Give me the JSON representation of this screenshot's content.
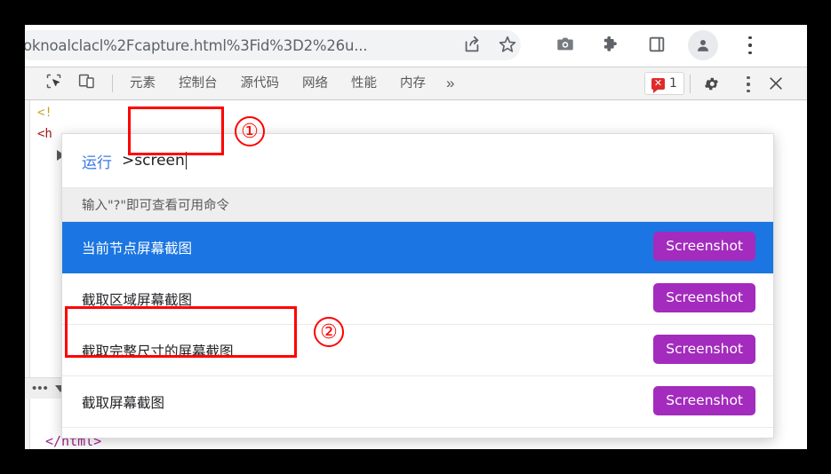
{
  "browser": {
    "omnibox": {
      "url": "oknoalclacl%2Fcapture.html%3Fid%3D2%26u...",
      "icons": [
        "share-icon",
        "star-icon",
        "camera-icon",
        "puzzle-icon",
        "side-panel-icon",
        "avatar-icon",
        "chrome-menu-icon"
      ]
    }
  },
  "devtools": {
    "icons": {
      "inspect": "inspect-element-icon",
      "device": "device-toolbar-icon"
    },
    "tabs": [
      {
        "label": "元素"
      },
      {
        "label": "控制台"
      },
      {
        "label": "源代码"
      },
      {
        "label": "网络"
      },
      {
        "label": "性能"
      },
      {
        "label": "内存"
      }
    ],
    "more_tabs_label": "»",
    "error_badge": {
      "count": "1",
      "mark": "✕"
    },
    "right_icons": [
      "gear-icon",
      "devtools-menu-icon",
      "close-icon"
    ]
  },
  "dom_panel": {
    "line1": "<!",
    "line2": "<h",
    "closing_tag": "</html>",
    "footer_dots": "•••"
  },
  "palette": {
    "run_label": "运行",
    "query": ">screen",
    "placeholder": ">screen",
    "hint": "输入\"?\"即可查看可用命令",
    "commands": [
      {
        "label": "当前节点屏幕截图",
        "tag": "Screenshot",
        "selected": true
      },
      {
        "label": "截取区域屏幕截图",
        "tag": "Screenshot",
        "selected": false
      },
      {
        "label": "截取完整尺寸的屏幕截图",
        "tag": "Screenshot",
        "selected": false
      },
      {
        "label": "截取屏幕截图",
        "tag": "Screenshot",
        "selected": false
      }
    ]
  },
  "annotations": [
    {
      "number": "①"
    },
    {
      "number": "②"
    }
  ],
  "colors": {
    "selected_row": "#1b75e2",
    "tag_purple": "#a32bbd",
    "annotation_red": "#ff0000",
    "run_label_blue": "#3b78e7",
    "error_red": "#e02b2b"
  }
}
